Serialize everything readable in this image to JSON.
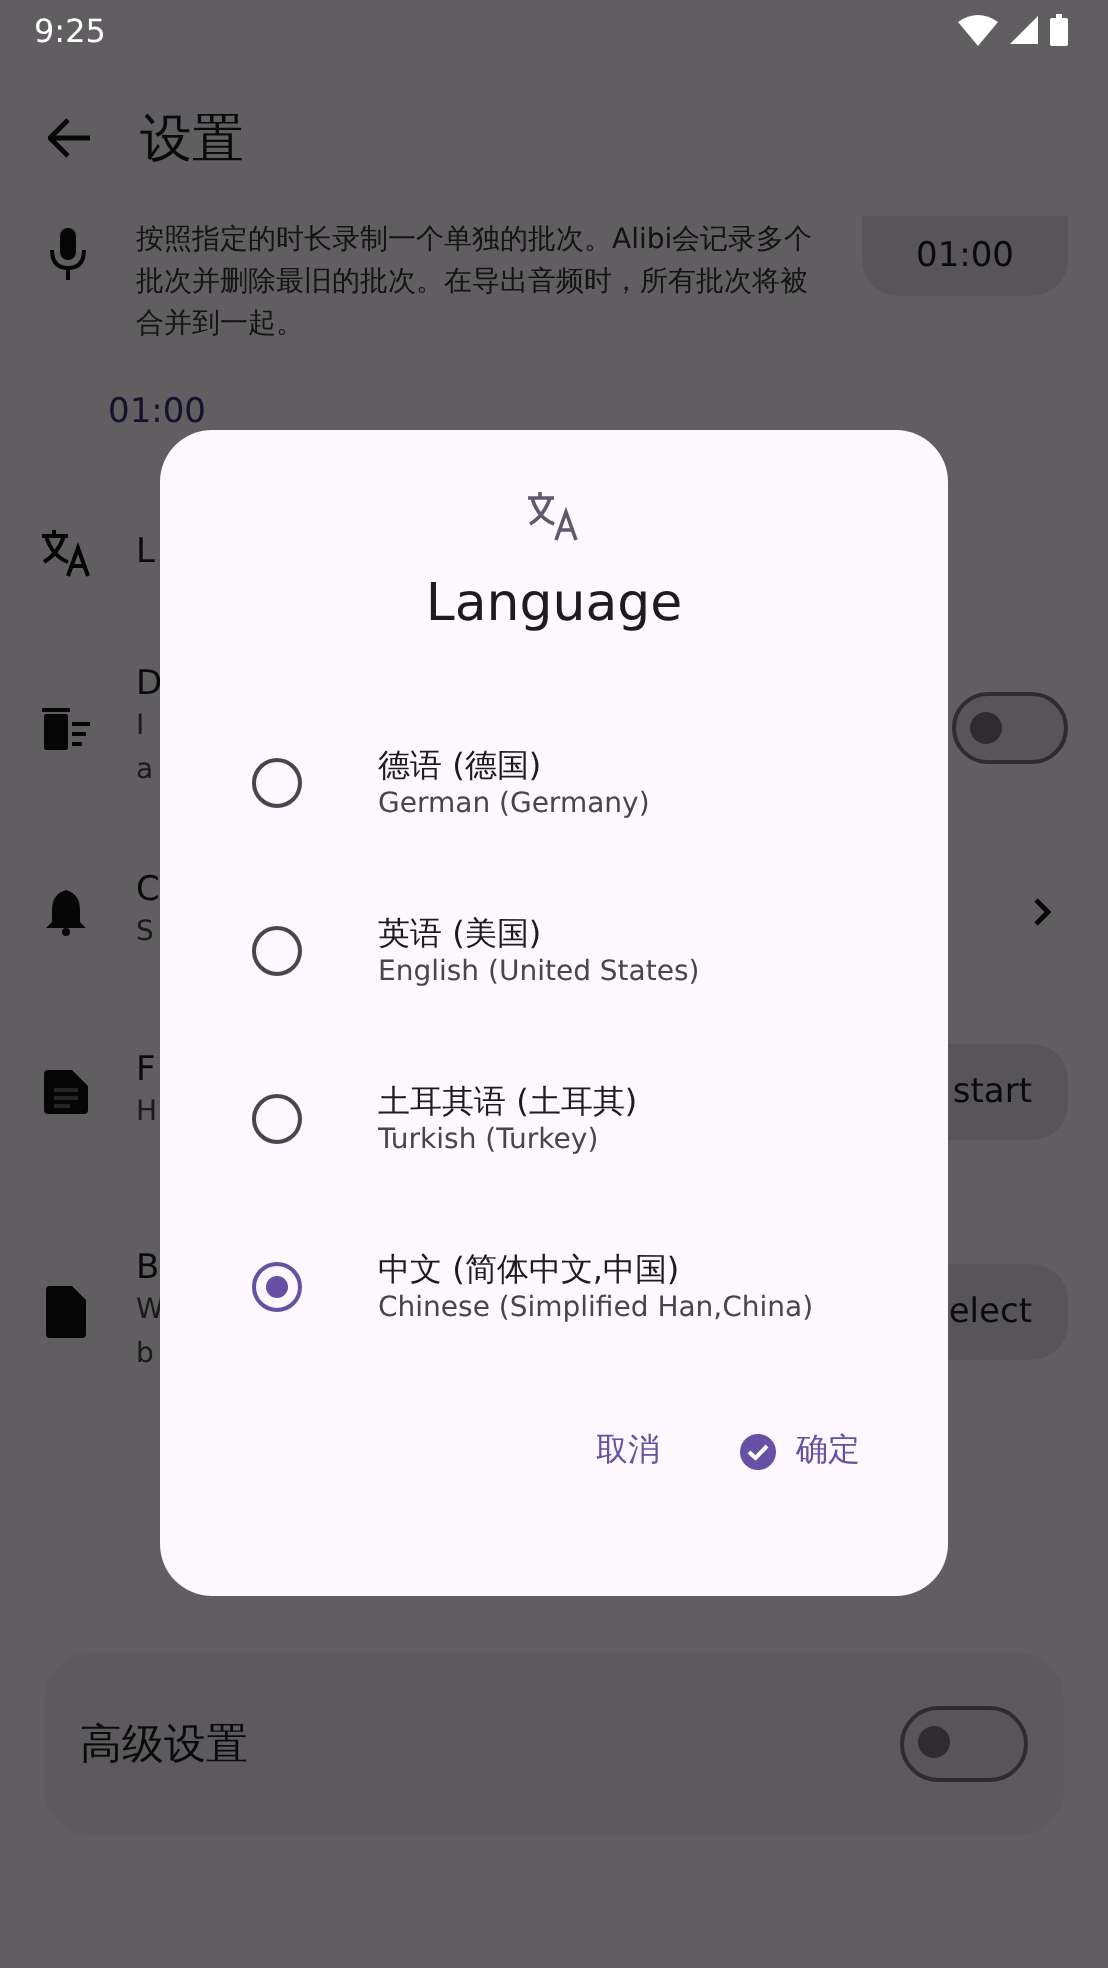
{
  "status_bar": {
    "time": "9:25"
  },
  "app_bar": {
    "title": "设置"
  },
  "batch_row": {
    "description": "按照指定的时长录制一个单独的批次。Alibi会记录多个批次并删除最旧的批次。在导出音频时，所有批次将被合并到一起。",
    "value": "01:00"
  },
  "durations": [
    "01:00"
  ],
  "settings": [
    {
      "kind": "plain",
      "title": "L"
    },
    {
      "kind": "switch",
      "title": "D",
      "subtitle": [
        "I",
        "a"
      ],
      "on": false
    },
    {
      "kind": "link",
      "title": "C",
      "subtitle": [
        "S"
      ]
    },
    {
      "kind": "button",
      "title": "F",
      "subtitle": [
        "H"
      ],
      "button": "start"
    },
    {
      "kind": "button",
      "title": "B",
      "subtitle": [
        "W",
        "b"
      ],
      "button": "elect"
    }
  ],
  "advanced": {
    "label": "高级设置",
    "on": false
  },
  "dialog": {
    "title": "Language",
    "options": [
      {
        "name": "德语 (德国)",
        "english": "German (Germany)",
        "selected": false
      },
      {
        "name": "英语 (美国)",
        "english": "English (United States)",
        "selected": false
      },
      {
        "name": "土耳其语 (土耳其)",
        "english": "Turkish (Turkey)",
        "selected": false
      },
      {
        "name": "中文 (简体中文,中国)",
        "english": "Chinese (Simplified Han,China)",
        "selected": true
      }
    ],
    "cancel": "取消",
    "confirm": "确定"
  }
}
